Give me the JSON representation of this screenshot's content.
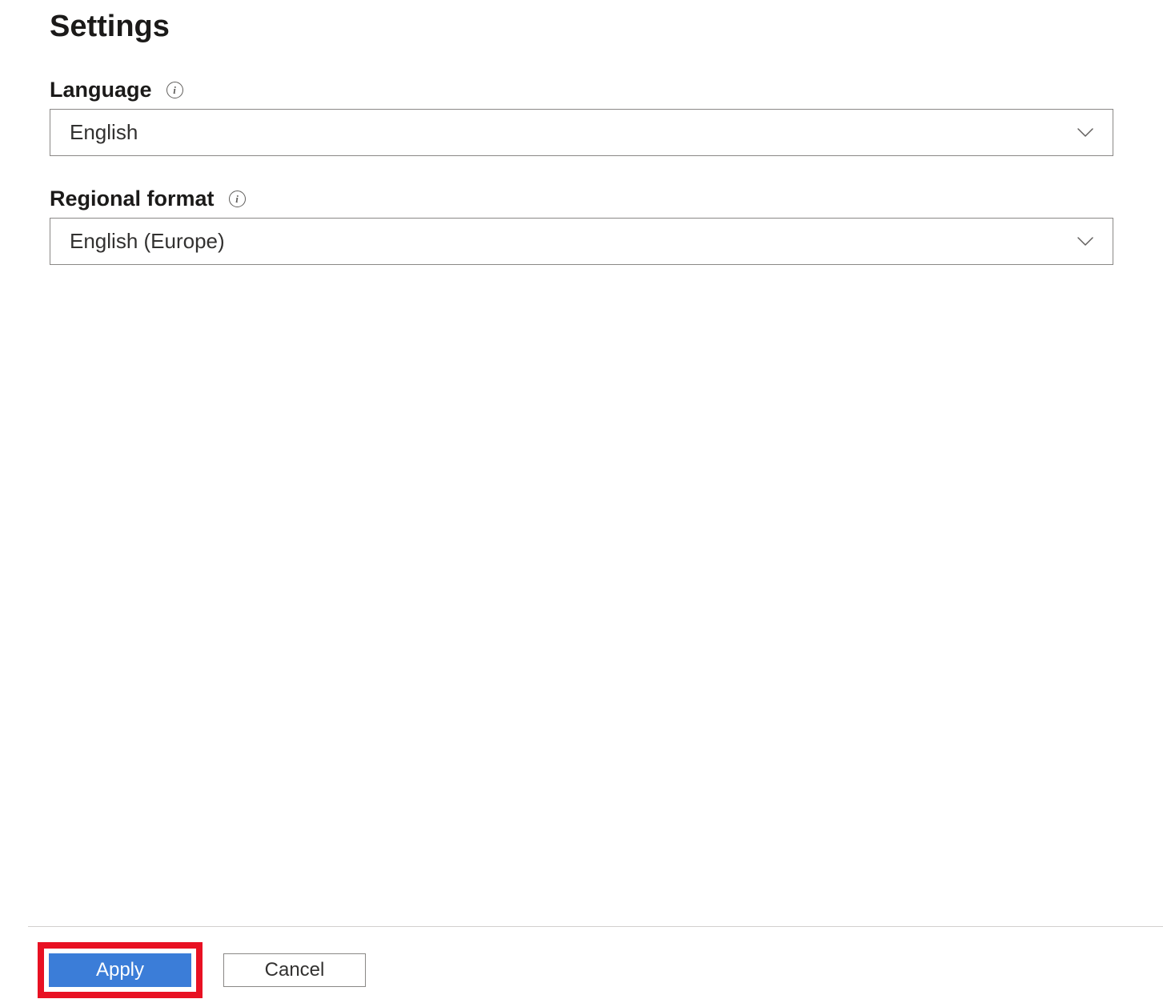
{
  "page": {
    "title": "Settings"
  },
  "fields": {
    "language": {
      "label": "Language",
      "value": "English"
    },
    "regional_format": {
      "label": "Regional format",
      "value": "English (Europe)"
    }
  },
  "buttons": {
    "apply": "Apply",
    "cancel": "Cancel"
  }
}
